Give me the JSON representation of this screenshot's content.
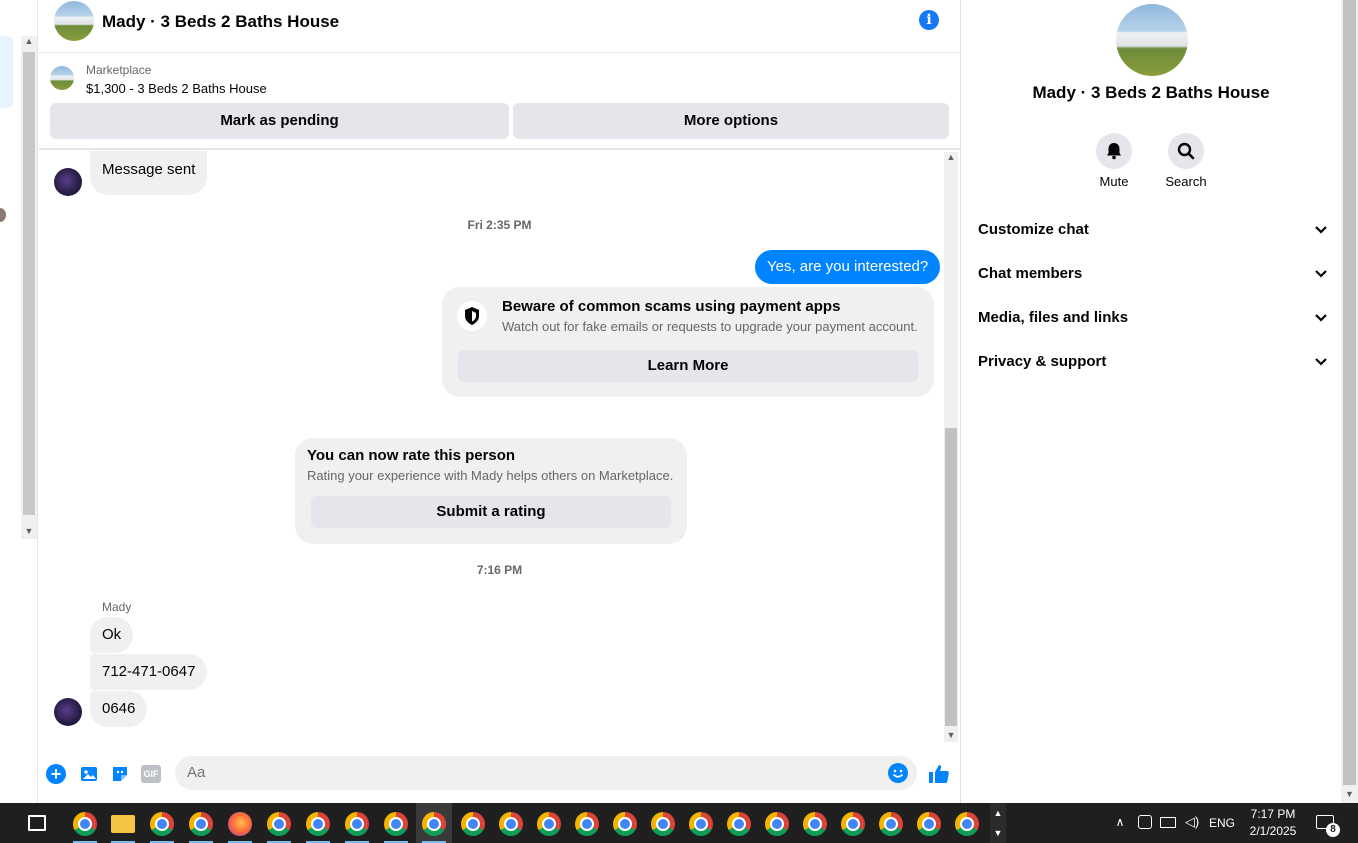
{
  "conversation": {
    "title": "Mady · 3 Beds 2 Baths House",
    "info_icon": "info-icon"
  },
  "listing": {
    "source": "Marketplace",
    "price_title": "$1,300 - 3 Beds 2 Baths House",
    "mark_pending": "Mark as pending",
    "more_options": "More options"
  },
  "messages": {
    "sent_status": "Message sent",
    "time1": "Fri 2:35 PM",
    "outgoing": "Yes, are you interested?",
    "scam_title": "Beware of common scams using payment apps",
    "scam_body": "Watch out for fake emails or requests to upgrade your payment account.",
    "scam_button": "Learn More",
    "rate_title": "You can now rate this person",
    "rate_body": "Rating your experience with Mady helps others on Marketplace.",
    "rate_button": "Submit a rating",
    "time2": "7:16 PM",
    "sender_name": "Mady",
    "incoming": [
      "Ok",
      "712-471-0647",
      "0646"
    ]
  },
  "composer": {
    "placeholder": "Aa"
  },
  "right_panel": {
    "title": "Mady · 3 Beds 2 Baths House",
    "mute": "Mute",
    "search": "Search",
    "sections": [
      "Customize chat",
      "Chat members",
      "Media, files and links",
      "Privacy & support"
    ]
  },
  "taskbar": {
    "language": "ENG",
    "time": "7:17 PM",
    "date": "2/1/2025",
    "notification_count": "8"
  },
  "colors": {
    "accent": "#0084ff",
    "brand_blue": "#1877f2",
    "bubble_gray": "#f0f0f0",
    "button_gray": "#e4e6eb",
    "taskbar": "#1f1f1f"
  }
}
